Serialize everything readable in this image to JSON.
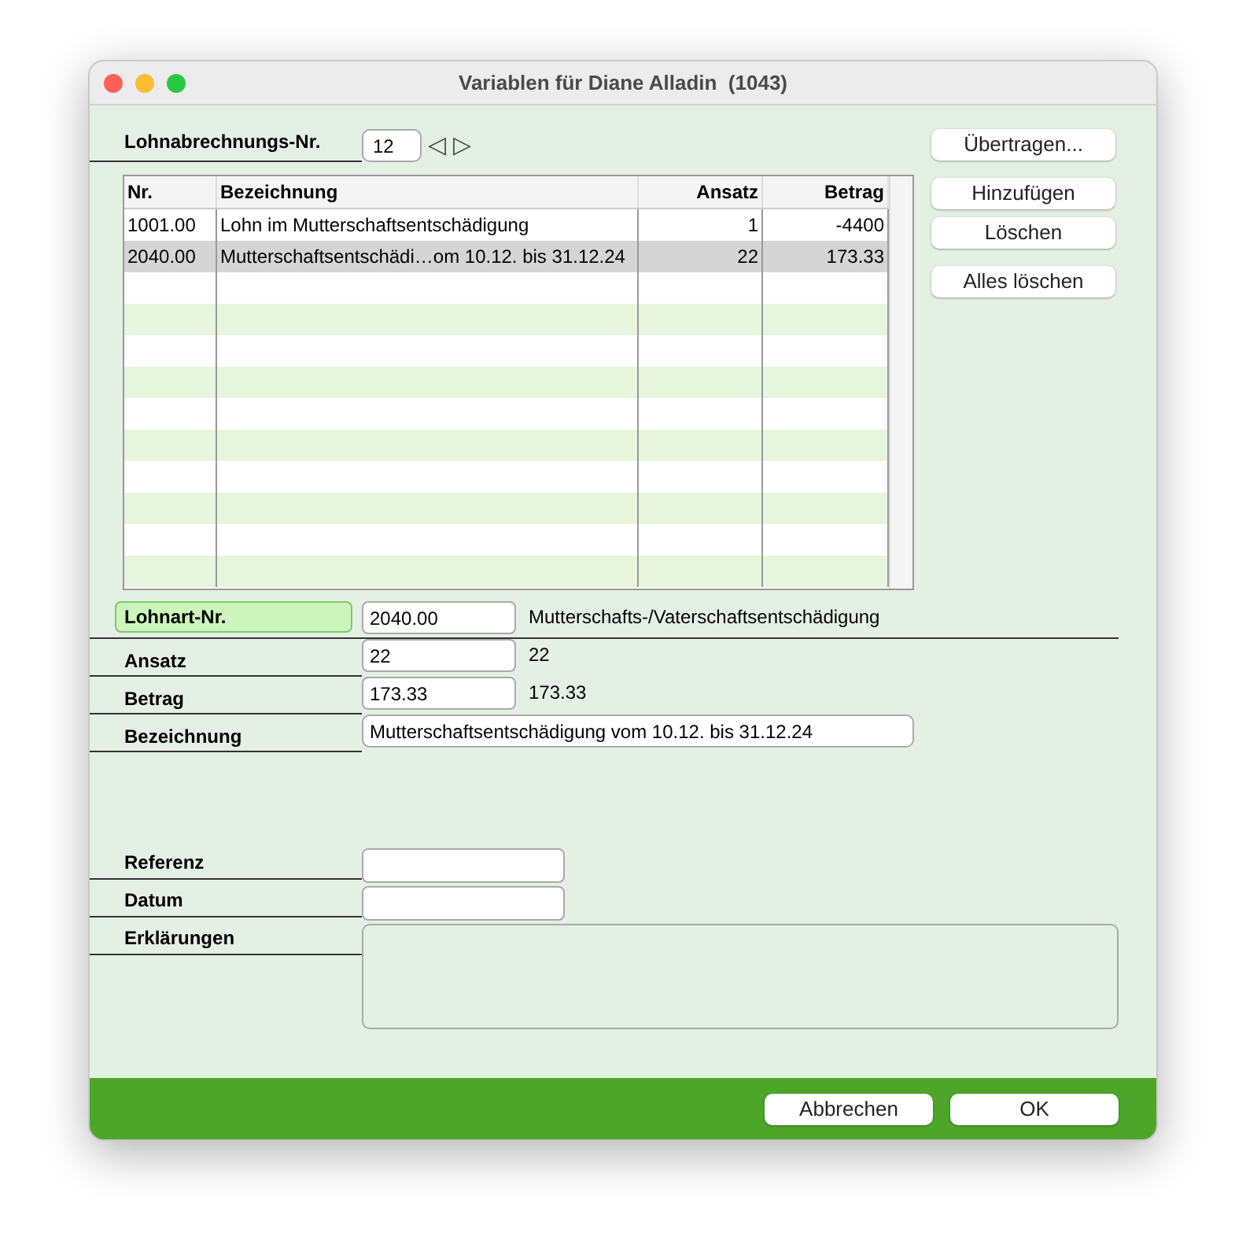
{
  "window": {
    "title": "Variablen für Diane Alladin  (1043)"
  },
  "period": {
    "label": "Lohnabrechnungs-Nr.",
    "value": "12",
    "prev": "◁",
    "next": "▷"
  },
  "table": {
    "columns": [
      {
        "label": "Nr."
      },
      {
        "label": "Bezeichnung"
      },
      {
        "label": "Ansatz"
      },
      {
        "label": "Betrag"
      }
    ],
    "rows": [
      {
        "cells": [
          "1001.00",
          "Lohn im Mutterschaftsentschädigung",
          "1",
          "-4400"
        ],
        "selected": false
      },
      {
        "cells": [
          "2040.00",
          "Mutterschaftsentschädi…om 10.12. bis 31.12.24",
          "22",
          "173.33"
        ],
        "selected": true
      }
    ]
  },
  "side_buttons": [
    {
      "label": "Übertragen..."
    },
    {
      "label": "Hinzufügen"
    },
    {
      "label": "Löschen"
    },
    {
      "label": "Alles löschen"
    }
  ],
  "form": [
    {
      "label": "Lohnart-Nr.",
      "value": "2040.00",
      "info": "Mutterschafts-/Vaterschaftsentschädigung",
      "highlighted": true,
      "kind": "short"
    },
    {
      "label": "Ansatz",
      "value": "22",
      "info": "22",
      "highlighted": false,
      "kind": "short"
    },
    {
      "label": "Betrag",
      "value": "173.33",
      "info": "173.33",
      "highlighted": false,
      "kind": "short"
    },
    {
      "label": "Bezeichnung",
      "value": "Mutterschaftsentschädigung vom 10.12. bis 31.12.24",
      "highlighted": false,
      "kind": "long"
    }
  ],
  "extra": [
    {
      "label": "Referenz",
      "kind": "short"
    },
    {
      "label": "Datum",
      "kind": "short"
    },
    {
      "label": "Erklärungen",
      "kind": "area"
    }
  ],
  "footer": {
    "buttons": [
      "Abbrechen",
      "OK"
    ]
  }
}
